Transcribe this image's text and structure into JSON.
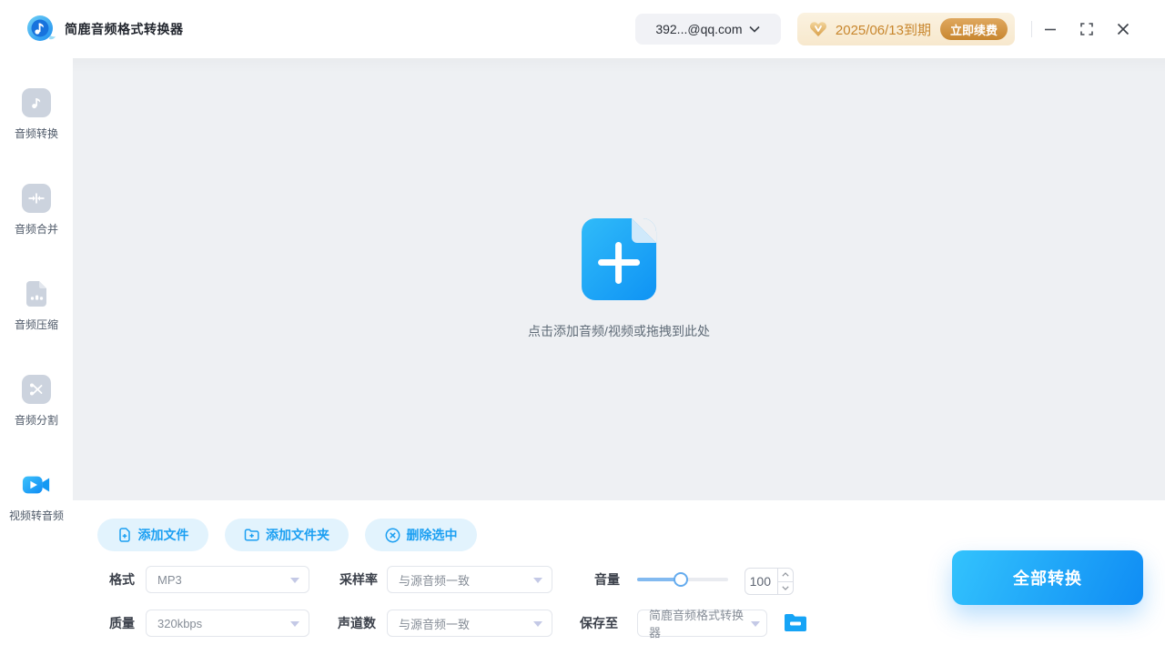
{
  "app": {
    "title": "简鹿音频格式转换器"
  },
  "topbar": {
    "account": "392...@qq.com",
    "vip": {
      "expiry": "2025/06/13到期",
      "renew_label": "立即续费"
    }
  },
  "window_controls": {
    "minimize": "minimize",
    "maximize": "maximize",
    "close": "close"
  },
  "sidebar": {
    "items": [
      {
        "label": "音频转换",
        "icon": "music-note-icon",
        "active": false
      },
      {
        "label": "音频合并",
        "icon": "merge-arrows-icon",
        "active": false
      },
      {
        "label": "音频压缩",
        "icon": "compress-file-icon",
        "active": false
      },
      {
        "label": "音频分割",
        "icon": "scissors-icon",
        "active": false
      },
      {
        "label": "视频转音频",
        "icon": "video-camera-icon",
        "active": true
      }
    ]
  },
  "dropzone": {
    "hint": "点击添加音频/视频或拖拽到此处"
  },
  "actions": {
    "add_file": "添加文件",
    "add_folder": "添加文件夹",
    "delete_selected": "删除选中"
  },
  "settings": {
    "format": {
      "label": "格式",
      "value": "MP3"
    },
    "sample_rate": {
      "label": "采样率",
      "value": "与源音频一致"
    },
    "volume": {
      "label": "音量",
      "value": "100",
      "percent": 48
    },
    "quality": {
      "label": "质量",
      "value": "320kbps"
    },
    "channels": {
      "label": "声道数",
      "value": "与源音频一致"
    },
    "save_to": {
      "label": "保存至",
      "value": "简鹿音频格式转换器"
    }
  },
  "convert": {
    "label": "全部转换"
  },
  "colors": {
    "accent_blue": "#1b9ff2",
    "button_gradient_start": "#33c3fd",
    "button_gradient_end": "#0f8cf4",
    "pill_bg": "#e2f3fd",
    "gold_text": "#c8862d",
    "gold_badge_bg": "#f7e8cd",
    "main_bg": "#eef0f3",
    "icon_gray": "#ccd3de"
  }
}
